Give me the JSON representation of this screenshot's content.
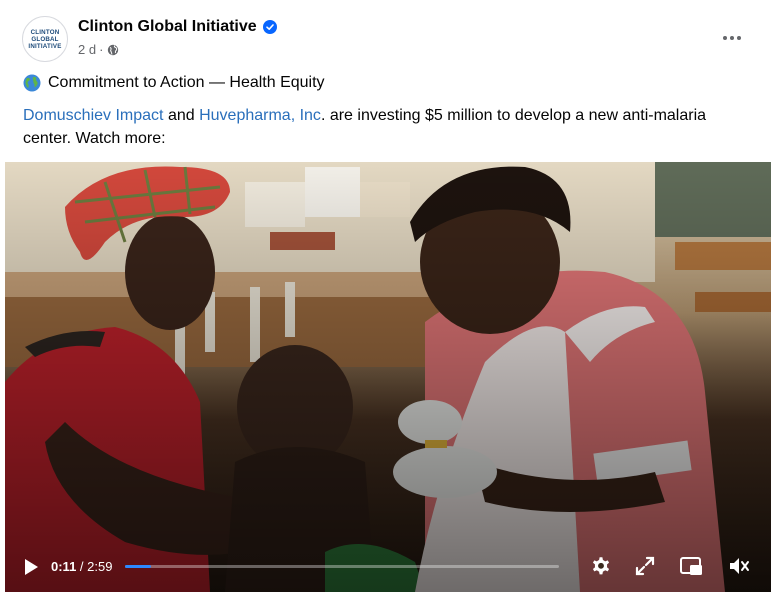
{
  "post": {
    "page_name": "Clinton Global Initiative",
    "avatar_text": [
      "CLINTON",
      "GLOBAL",
      "INITIATIVE"
    ],
    "timestamp": "2 d",
    "privacy_icon": "globe-icon",
    "verified_icon": "verified-badge-icon",
    "headline": "Commitment to Action — Health Equity",
    "headline_icon": "earth-globe-emoji",
    "body": {
      "link1": "Domuschiev Impact",
      "and": " and ",
      "link2": "Huvepharma, Inc",
      "rest": ". are investing $5 million to develop a new anti-malaria center. Watch more:"
    }
  },
  "video": {
    "current_time": "0:11",
    "separator": " / ",
    "duration": "2:59",
    "progress_fraction": 0.061,
    "controls": [
      "play-icon",
      "settings-icon",
      "fullscreen-icon",
      "picture-in-picture-icon",
      "mute-icon"
    ]
  },
  "colors": {
    "link": "#2a6fbb",
    "verified": "#0866ff",
    "progress": "#2d88ff",
    "meta_text": "#65676b"
  }
}
